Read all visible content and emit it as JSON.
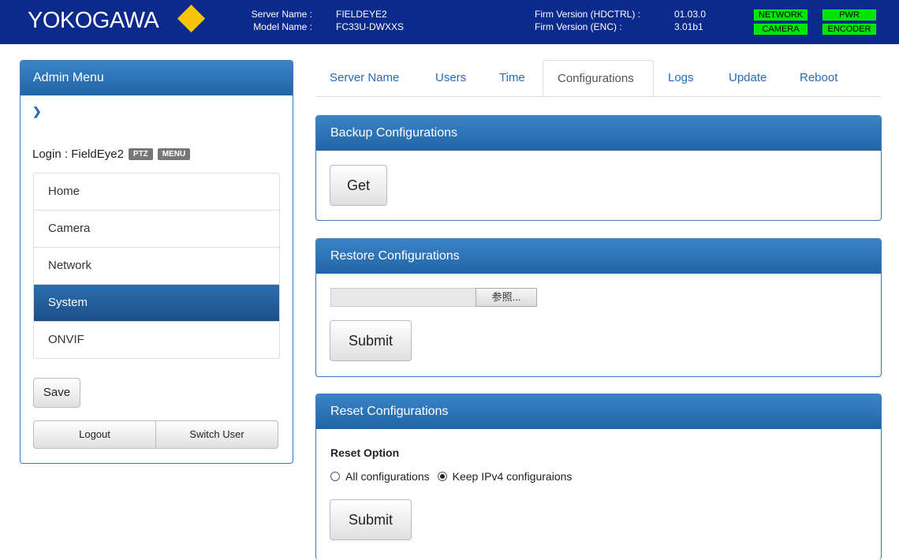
{
  "header": {
    "logo_text": "YOKOGAWA",
    "server_name_label": "Server Name :",
    "server_name": "FIELDEYE2",
    "model_name_label": "Model Name :",
    "model_name": "FC33U-DWXXS",
    "firm_hdctrl_label": "Firm Version (HDCTRL) :",
    "firm_hdctrl": "01.03.0",
    "firm_enc_label": "Firm Version (ENC) :",
    "firm_enc": "3.01b1",
    "badges": [
      "NETWORK",
      "PWR",
      "CAMERA",
      "ENCODER"
    ],
    "badge_color": "#00e400"
  },
  "sidebar": {
    "title": "Admin Menu",
    "login_text": "Login : FieldEye2",
    "tags": [
      "PTZ",
      "MENU"
    ],
    "items": [
      {
        "label": "Home"
      },
      {
        "label": "Camera"
      },
      {
        "label": "Network"
      },
      {
        "label": "System"
      },
      {
        "label": "ONVIF"
      }
    ],
    "active_item": "System",
    "save_label": "Save",
    "logout_label": "Logout",
    "switch_user_label": "Switch User"
  },
  "tabs": [
    {
      "label": "Server Name"
    },
    {
      "label": "Users"
    },
    {
      "label": "Time"
    },
    {
      "label": "Configurations"
    },
    {
      "label": "Logs"
    },
    {
      "label": "Update"
    },
    {
      "label": "Reboot"
    }
  ],
  "active_tab": "Configurations",
  "backup": {
    "title": "Backup Configurations",
    "get_label": "Get"
  },
  "restore": {
    "title": "Restore Configurations",
    "file_value": "",
    "browse_label": "参照...",
    "submit_label": "Submit"
  },
  "reset": {
    "title": "Reset Configurations",
    "option_label": "Reset Option",
    "options": [
      {
        "label": "All configurations",
        "selected": false
      },
      {
        "label": "Keep IPv4 configuraions",
        "selected": true
      }
    ],
    "submit_label": "Submit"
  },
  "colors": {
    "topbar": "#0b2a8c",
    "accent": "#2a6bb0",
    "logo_diamond": "#f6c40a"
  }
}
